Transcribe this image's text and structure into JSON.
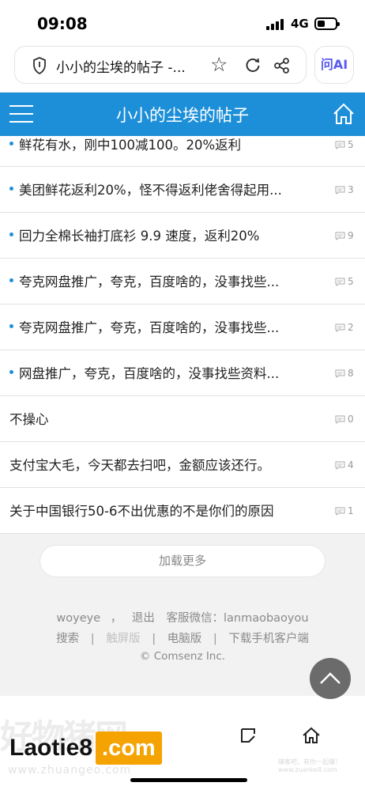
{
  "status_bar": {
    "time": "09:08",
    "network": "4G",
    "battery_level": 0.3
  },
  "browser": {
    "url_text": "小小的尘埃的帖子 -...",
    "ai_label": "问AI",
    "icons": [
      "shield-icon",
      "star-icon",
      "reload-icon",
      "share-icon"
    ]
  },
  "header": {
    "title": "小小的尘埃的帖子",
    "icons": [
      "menu-icon",
      "home-icon"
    ]
  },
  "posts": [
    {
      "title": "鲜花有水，刚中100减100。20%返利",
      "replies": "5",
      "dot": true
    },
    {
      "title": "美团鲜花返利20%，怪不得返利佬舍得起用...",
      "replies": "3",
      "dot": true
    },
    {
      "title": "回力全棉长袖打底衫 9.9 速度，返利20%",
      "replies": "9",
      "dot": true
    },
    {
      "title": "夸克网盘推广，夸克，百度啥的，没事找些...",
      "replies": "5",
      "dot": true
    },
    {
      "title": "夸克网盘推广，夸克，百度啥的，没事找些...",
      "replies": "2",
      "dot": true
    },
    {
      "title": "网盘推广，夸克，百度啥的，没事找些资料...",
      "replies": "8",
      "dot": true
    },
    {
      "title": "不操心",
      "replies": "0",
      "dot": false
    },
    {
      "title": "支付宝大毛，今天都去扫吧，金额应该还行。",
      "replies": "4",
      "dot": false
    },
    {
      "title": "关于中国银行50-6不出优惠的不是你们的原因",
      "replies": "1",
      "dot": false
    }
  ],
  "load_more": "加载更多",
  "footer": {
    "user": "woyeye",
    "comma": "，",
    "logout": "退出",
    "service": "客服微信：lanmaobaoyou",
    "links": [
      "搜索",
      "触屏版",
      "电脑版",
      "下载手机客户端"
    ],
    "separator": "|",
    "copyright": "© Comsenz Inc."
  },
  "watermark": {
    "big": "好物猪网",
    "logo_left": "Laotie8",
    "logo_right": ".com",
    "url": "www.zhuangeo.com",
    "right_text": "赚客吧，有你一起赚！ www.zuanke8.com"
  },
  "colors": {
    "header_bg": "#1d8fd8",
    "dot": "#1d8fd8",
    "logo_orange": "#f5a300",
    "to_top_bg": "#6b6b6b"
  }
}
